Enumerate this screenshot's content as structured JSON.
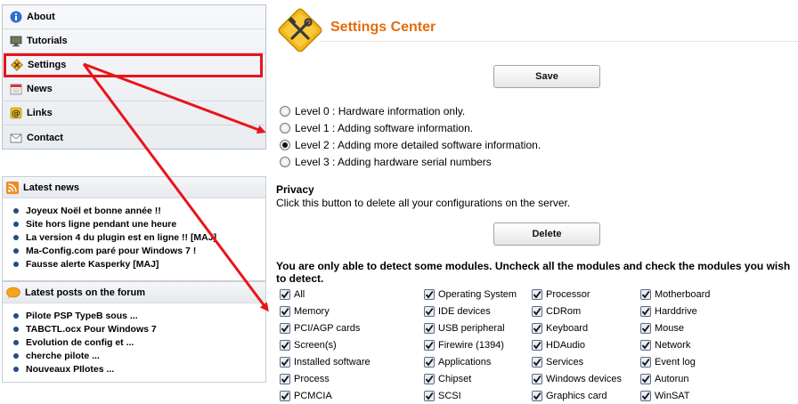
{
  "nav": {
    "items": [
      {
        "key": "about",
        "label": "About",
        "icon": "info-icon"
      },
      {
        "key": "tutorials",
        "label": "Tutorials",
        "icon": "monitor-icon"
      },
      {
        "key": "settings",
        "label": "Settings",
        "icon": "settings-icon",
        "active": true
      },
      {
        "key": "news",
        "label": "News",
        "icon": "calendar-icon"
      },
      {
        "key": "links",
        "label": "Links",
        "icon": "at-icon"
      },
      {
        "key": "contact",
        "label": "Contact",
        "icon": "envelope-icon"
      }
    ]
  },
  "latest_news": {
    "title": "Latest news",
    "items": [
      "Joyeux Noël et bonne année !!",
      "Site hors ligne pendant une heure",
      "La version 4 du plugin est en ligne !! [MAJ]",
      "Ma-Config.com paré pour Windows 7 !",
      "Fausse alerte Kasperky [MAJ]"
    ]
  },
  "forum": {
    "title": "Latest posts on the forum",
    "items": [
      "Pilote PSP TypeB sous ...",
      "TABCTL.ocx Pour Windows 7",
      "Evolution de config et ...",
      "cherche pilote ...",
      "Nouveaux PIlotes ..."
    ]
  },
  "main": {
    "title": "Settings Center",
    "save_label": "Save",
    "levels": [
      {
        "label": "Level 0 : Hardware information only.",
        "selected": false
      },
      {
        "label": "Level 1 : Adding software information.",
        "selected": false
      },
      {
        "label": "Level 2 : Adding more detailed software information.",
        "selected": true
      },
      {
        "label": "Level 3 : Adding hardware serial numbers",
        "selected": false
      }
    ],
    "privacy_title": "Privacy",
    "privacy_text": "Click this button to delete all your configurations on the server.",
    "delete_label": "Delete",
    "modules_intro": "You are only able to detect some modules. Uncheck all the modules and check the modules you wish to detect.",
    "modules": [
      [
        "All",
        "Operating System",
        "Processor",
        "Motherboard"
      ],
      [
        "Memory",
        "IDE devices",
        "CDRom",
        "Harddrive"
      ],
      [
        "PCI/AGP cards",
        "USB peripheral",
        "Keyboard",
        "Mouse"
      ],
      [
        "Screen(s)",
        "Firewire (1394)",
        "HDAudio",
        "Network"
      ],
      [
        "Installed software",
        "Applications",
        "Services",
        "Event log"
      ],
      [
        "Process",
        "Chipset",
        "Windows devices",
        "Autorun"
      ],
      [
        "PCMCIA",
        "SCSI",
        "Graphics card",
        "WinSAT"
      ]
    ],
    "modules_checked": true
  },
  "colors": {
    "accent_orange": "#e36c0a",
    "highlight_red": "#e8141a",
    "bullet_blue": "#274a86"
  }
}
